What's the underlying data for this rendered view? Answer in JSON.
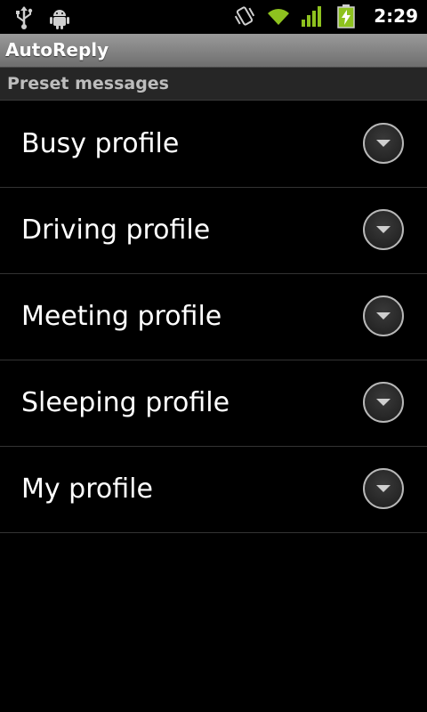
{
  "status_bar": {
    "time": "2:29",
    "icons_left": [
      "usb-icon",
      "android-debug-icon"
    ],
    "icons_right": [
      "vibrate-icon",
      "wifi-icon",
      "signal-icon",
      "battery-charging-icon"
    ]
  },
  "app": {
    "title": "AutoReply"
  },
  "section": {
    "title": "Preset messages"
  },
  "profiles": [
    {
      "label": "Busy profile"
    },
    {
      "label": "Driving profile"
    },
    {
      "label": "Meeting profile"
    },
    {
      "label": "Sleeping profile"
    },
    {
      "label": "My profile"
    }
  ],
  "colors": {
    "accent_green": "#8ec21f",
    "title_bar": "#8a8a8a",
    "section_bg": "#262626"
  }
}
